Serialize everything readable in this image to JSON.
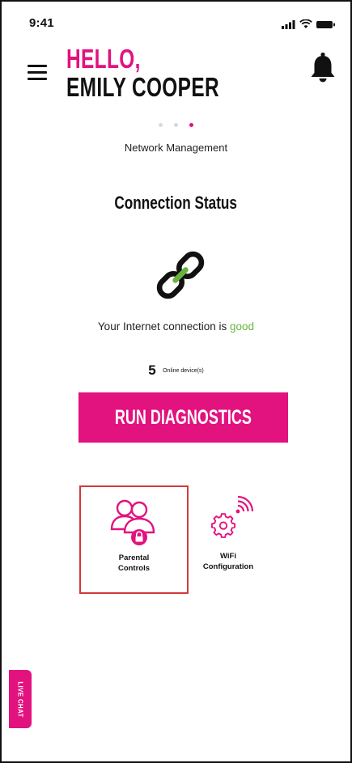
{
  "status_bar": {
    "time": "9:41"
  },
  "header": {
    "greeting_line1": "HELLO,",
    "greeting_line2": "EMILY COOPER"
  },
  "carousel": {
    "dots": 3,
    "active_index": 2,
    "section_label": "Network Management"
  },
  "connection": {
    "title": "Connection Status",
    "status_prefix": "Your Internet connection is ",
    "status_value": "good",
    "device_count": "5",
    "device_label": "Online device(s)"
  },
  "actions": {
    "run_diagnostics_label": "RUN DIAGNOSTICS"
  },
  "tiles": [
    {
      "line1": "Parental",
      "line2": "Controls",
      "icon": "parental-controls-icon",
      "selected": true
    },
    {
      "line1": "WiFi",
      "line2": "Configuration",
      "icon": "wifi-settings-icon",
      "selected": false
    }
  ],
  "live_chat": {
    "label": "LIVE CHAT"
  },
  "colors": {
    "accent": "#e2127f",
    "good": "#69b43d",
    "selection_border": "#d33a3a",
    "text": "#111111"
  }
}
